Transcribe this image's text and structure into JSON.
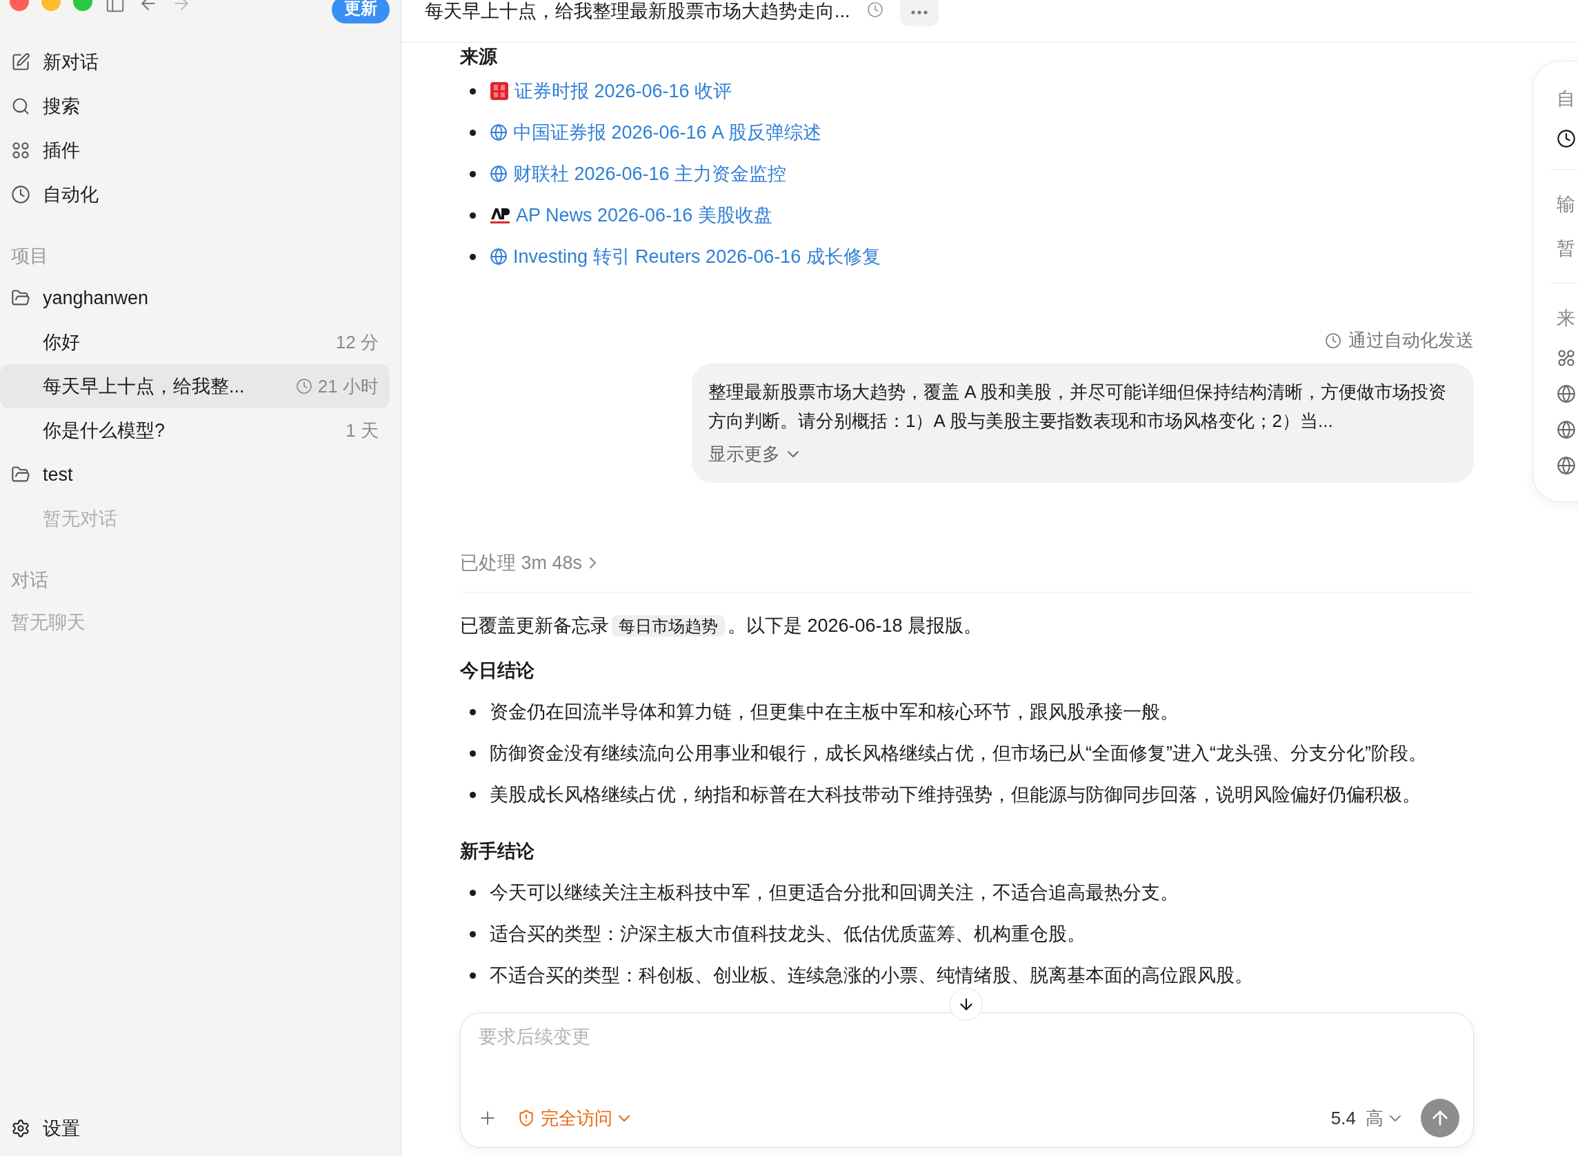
{
  "sidebar": {
    "update_button": "更新",
    "nav": [
      {
        "label": "新对话",
        "kind": "compose"
      },
      {
        "label": "搜索",
        "kind": "search"
      },
      {
        "label": "插件",
        "kind": "plugins"
      },
      {
        "label": "自动化",
        "kind": "automation"
      }
    ],
    "projects": {
      "heading": "项目",
      "folders": [
        {
          "name": "yanghanwen",
          "chats": [
            {
              "title": "你好",
              "time": "12 分",
              "selected": false,
              "automated": false
            },
            {
              "title": "每天早上十点，给我整...",
              "time": "21 小时",
              "selected": true,
              "automated": true
            },
            {
              "title": "你是什么模型?",
              "time": "1 天",
              "selected": false,
              "automated": false
            }
          ]
        },
        {
          "name": "test",
          "empty_text": "暂无对话"
        }
      ]
    },
    "conversations": {
      "heading": "对话",
      "empty_text": "暂无聊天"
    },
    "settings": "设置"
  },
  "main": {
    "title": "每天早上十点，给我整理最新股票市场大趋势走向...",
    "sources_heading": "来源",
    "sources": [
      {
        "label": "证券时报 2026-06-16 收评",
        "kind": "seal"
      },
      {
        "label": "中国证券报 2026-06-16 A 股反弹综述",
        "kind": "globe"
      },
      {
        "label": "财联社 2026-06-16 主力资金监控",
        "kind": "globe"
      },
      {
        "label": "AP News 2026-06-16 美股收盘",
        "kind": "ap"
      },
      {
        "label": "Investing 转引 Reuters 2026-06-16 成长修复",
        "kind": "globe"
      }
    ],
    "automation_note": "通过自动化发送",
    "prompt": {
      "text": "整理最新股票市场大趋势，覆盖 A 股和美股，并尽可能详细但保持结构清晰，方便做市场投资方向判断。请分别概括：1）A 股与美股主要指数表现和市场风格变化；2）当...",
      "show_more": "显示更多"
    },
    "processed": "已处理 3m 48s",
    "reply": {
      "intro_before": "已覆盖更新备忘录",
      "memo": "每日市场趋势",
      "intro_after": "。以下是 2026-06-18 晨报版。",
      "sections": [
        {
          "heading": "今日结论",
          "bullets": [
            "资金仍在回流半导体和算力链，但更集中在主板中军和核心环节，跟风股承接一般。",
            "防御资金没有继续流向公用事业和银行，成长风格继续占优，但市场已从“全面修复”进入“龙头强、分支分化”阶段。",
            "美股成长风格继续占优，纳指和标普在大科技带动下维持强势，但能源与防御同步回落，说明风险偏好仍偏积极。"
          ]
        },
        {
          "heading": "新手结论",
          "bullets": [
            "今天可以继续关注主板科技中军，但更适合分批和回调关注，不适合追高最热分支。",
            "适合买的类型：沪深主板大市值科技龙头、低估优质蓝筹、机构重仓股。",
            "不适合买的类型：科创板、创业板、连续急涨的小票、纯情绪股、脱离基本面的高位跟风股。"
          ]
        }
      ]
    },
    "composer": {
      "placeholder": "要求后续变更",
      "access": "完全访问",
      "model": "5.4",
      "effort": "高"
    }
  },
  "side_panel": [
    {
      "kind": "label",
      "text": "自"
    },
    {
      "kind": "clock"
    },
    {
      "kind": "divider"
    },
    {
      "kind": "label",
      "text": "输"
    },
    {
      "kind": "label",
      "text": "暂"
    },
    {
      "kind": "divider"
    },
    {
      "kind": "label",
      "text": "来"
    },
    {
      "kind": "nodes"
    },
    {
      "kind": "globe"
    },
    {
      "kind": "globe"
    },
    {
      "kind": "globe"
    }
  ]
}
